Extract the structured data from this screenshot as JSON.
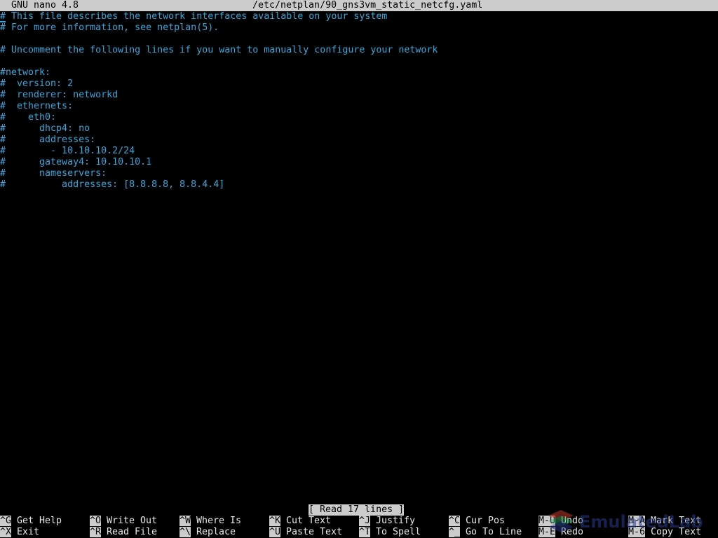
{
  "titlebar": {
    "app": "GNU nano 4.8",
    "filename": "/etc/netplan/90_gns3vm_static_netcfg.yaml"
  },
  "editor": {
    "lines": [
      "# This file describes the network interfaces available on your system",
      "# For more information, see netplan(5).",
      "",
      "# Uncomment the following lines if you want to manually configure your network",
      "",
      "#network:",
      "#  version: 2",
      "#  renderer: networkd",
      "#  ethernets:",
      "#    eth0:",
      "#      dhcp4: no",
      "#      addresses:",
      "#        - 10.10.10.2/24",
      "#      gateway4: 10.10.10.1",
      "#      nameservers:",
      "#          addresses: [8.8.8.8, 8.8.4.4]"
    ],
    "text_color": "#33a8dc"
  },
  "status": "[ Read 17 lines ]",
  "shortcuts": [
    [
      {
        "key": "^G",
        "label": "Get Help"
      },
      {
        "key": "^X",
        "label": "Exit"
      }
    ],
    [
      {
        "key": "^O",
        "label": "Write Out"
      },
      {
        "key": "^R",
        "label": "Read File"
      }
    ],
    [
      {
        "key": "^W",
        "label": "Where Is"
      },
      {
        "key": "^\\",
        "label": "Replace"
      }
    ],
    [
      {
        "key": "^K",
        "label": "Cut Text"
      },
      {
        "key": "^U",
        "label": "Paste Text"
      }
    ],
    [
      {
        "key": "^J",
        "label": "Justify"
      },
      {
        "key": "^T",
        "label": "To Spell"
      }
    ],
    [
      {
        "key": "^C",
        "label": "Cur Pos"
      },
      {
        "key": "^_",
        "label": "Go To Line"
      }
    ],
    [
      {
        "key": "M-U",
        "label": "Undo"
      },
      {
        "key": "M-E",
        "label": "Redo"
      }
    ],
    [
      {
        "key": "M-A",
        "label": "Mark Text"
      },
      {
        "key": "M-6",
        "label": "Copy Text"
      }
    ]
  ],
  "watermark": "EmulatedLab"
}
